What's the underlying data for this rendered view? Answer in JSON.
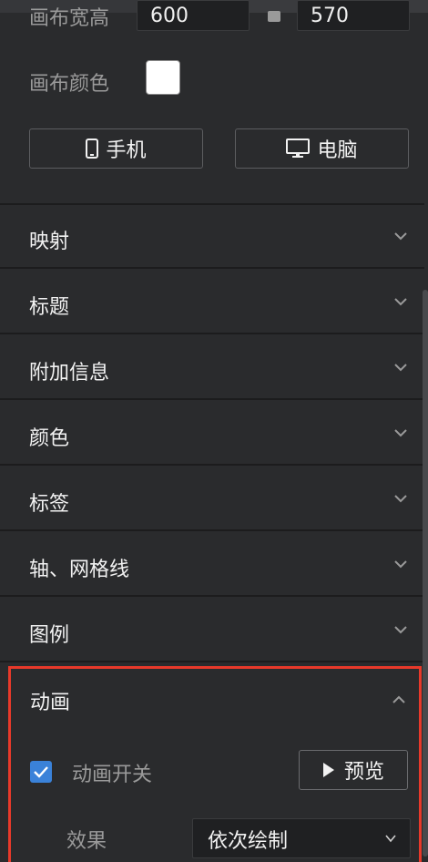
{
  "canvas": {
    "size_label": "画布宽高",
    "width_value": "600",
    "height_value": "570",
    "color_label": "画布颜色",
    "color_value": "#ffffff"
  },
  "device": {
    "mobile_label": "手机",
    "pc_label": "电脑"
  },
  "sections": [
    {
      "label": "映射"
    },
    {
      "label": "标题"
    },
    {
      "label": "附加信息"
    },
    {
      "label": "颜色"
    },
    {
      "label": "标签"
    },
    {
      "label": "轴、网格线"
    },
    {
      "label": "图例"
    }
  ],
  "animation": {
    "title": "动画",
    "switch_label": "动画开关",
    "switch_checked": true,
    "preview_label": "预览",
    "effect_label": "效果",
    "effect_value": "依次绘制"
  },
  "colors": {
    "highlight": "#e8392a",
    "checkbox": "#3a82d9",
    "panel_bg": "#2a2b2d"
  }
}
